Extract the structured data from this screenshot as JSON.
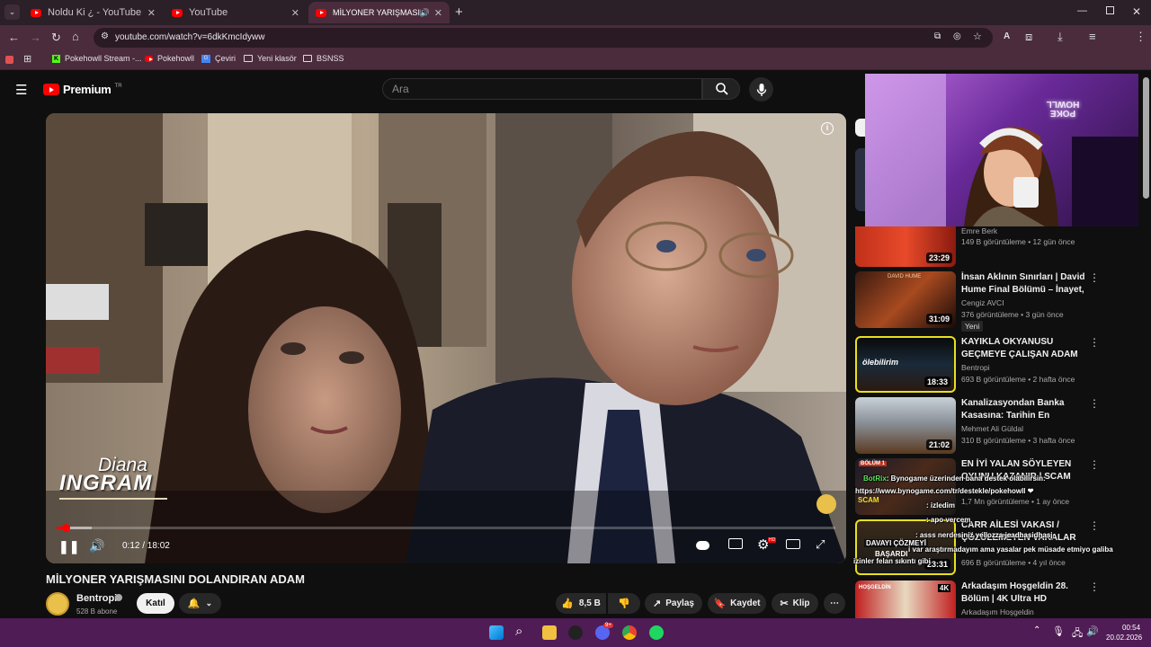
{
  "browser": {
    "tabs": [
      {
        "label": "Noldu Ki ¿ - YouTube"
      },
      {
        "label": "YouTube"
      },
      {
        "label": "MİLYONER YARIŞMASINI DO"
      }
    ],
    "url": "youtube.com/watch?v=6dkKmcIdyww",
    "bookmarks": [
      "Pokehowll Stream -...",
      "Pokehowll",
      "Çeviri",
      "Yeni klasör",
      "BSNSS"
    ]
  },
  "youtube": {
    "brand": "Premium",
    "brand_sup": "TR",
    "search_placeholder": "Ara"
  },
  "player": {
    "overlay_name_first": "Diana",
    "overlay_name_last": "INGRAM",
    "time": "0:12 / 18:02",
    "progress_fraction": 0.011,
    "buffered_fraction": 0.045,
    "hd_badge": "HD"
  },
  "video": {
    "title": "MİLYONER YARIŞMASINI DOLANDIRAN ADAM",
    "channel": "Bentropi",
    "subscribers": "528 B abone",
    "join_label": "Katıl",
    "likes": "8,5 B",
    "share_label": "Paylaş",
    "save_label": "Kaydet",
    "clip_label": "Klip"
  },
  "recommendations": [
    {
      "title": "",
      "channel": "Emre Berk",
      "meta": "149 B görüntüleme • 12 gün önce",
      "duration": "23:29"
    },
    {
      "title": "İnsan Aklının Sınırları | David Hume Final Bölümü – İnayet, ...",
      "channel": "Cengiz AVCI",
      "meta": "376 görüntüleme • 3 gün önce",
      "badge": "Yeni",
      "duration": "31:09"
    },
    {
      "title": "KAYIKLA OKYANUSU GEÇMEYE ÇALIŞAN ADAM",
      "channel": "Bentropi",
      "meta": "693 B görüntüleme • 2 hafta önce",
      "duration": "18:33"
    },
    {
      "title": "Kanalizasyondan Banka Kasasına: Tarihin En Kusursuz ...",
      "channel": "Mehmet Ali Güldal",
      "meta": "310 B görüntüleme • 3 hafta önce",
      "duration": "21:02"
    },
    {
      "title": "EN İYİ YALAN SÖYLEYEN OYUNU KAZANIR | SCAM LIN...",
      "channel": "",
      "meta": "1,7 Mn görüntüleme • 1 ay önce",
      "duration": ""
    },
    {
      "title": "CARR AİLESİ VAKASI / ÇÖZÜLEMEYEN VAKALAR",
      "channel": "",
      "meta": "696 B görüntüleme • 4 yıl önce",
      "duration": "23:31"
    },
    {
      "title": "Arkadaşım Hoşgeldin 28. Bölüm | 4K Ultra HD",
      "channel": "Arkadaşım Hoşgeldin",
      "meta": "",
      "duration": ""
    }
  ],
  "stream_chat": [
    {
      "user": "BotRix",
      "text": ": Bynogame üzerinden bana destek olabilirsin:"
    },
    {
      "user": "",
      "text": "https://www.bynogame.com/tr/destekle/pokehowll ❤"
    },
    {
      "user": "",
      "text": ": izledim"
    },
    {
      "user": "",
      "text": ": apo vercem"
    },
    {
      "user": "",
      "text": ": asss nerdesiniz yellozza jeadhasidhasj"
    },
    {
      "user": "",
      "text": "i var araştırmadayım ama yasalar pek müsade etmiyo galiba"
    },
    {
      "user": "",
      "text": "izinler felan sıkıntı gibi"
    }
  ],
  "thumb_text": {
    "david_hume": "DAVID HUME",
    "olebilirim": "ölebilirim",
    "bolum": "BÖLÜM 1",
    "scam": "SCAM",
    "davayi": "DAVAYI ÇÖZMEYİ",
    "basardi": "BAŞARDI",
    "hosgeldin": "HOŞGELDİN",
    "k4": "4K"
  },
  "webcam": {
    "neon_text": "POKE HOWLL"
  },
  "taskbar": {
    "time": "00:54",
    "date": "20.02.2026",
    "discord_badge": "9+"
  },
  "colors": {
    "accent_red": "#ff0000",
    "tab_bg": "#2b1f28",
    "chrome_bg": "#4a2c3c",
    "taskbar": "#501c55"
  }
}
